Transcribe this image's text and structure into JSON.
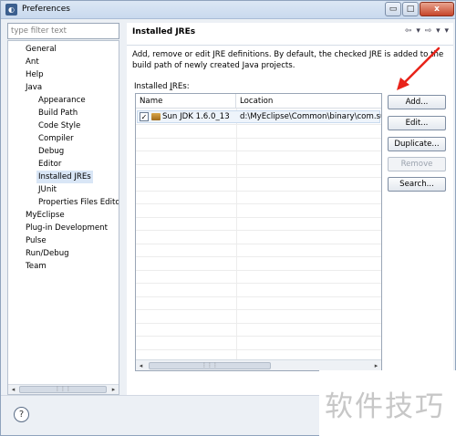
{
  "window": {
    "title": "Preferences",
    "controls": {
      "minimize": "▭",
      "maximize": "□",
      "close": "x"
    }
  },
  "sidebar": {
    "filter_placeholder": "type filter text",
    "tree": [
      {
        "label": "General",
        "level": 0
      },
      {
        "label": "Ant",
        "level": 0
      },
      {
        "label": "Help",
        "level": 0
      },
      {
        "label": "Java",
        "level": 0
      },
      {
        "label": "Appearance",
        "level": 1
      },
      {
        "label": "Build Path",
        "level": 1
      },
      {
        "label": "Code Style",
        "level": 1
      },
      {
        "label": "Compiler",
        "level": 1
      },
      {
        "label": "Debug",
        "level": 1
      },
      {
        "label": "Editor",
        "level": 1
      },
      {
        "label": "Installed JREs",
        "level": 1,
        "selected": true
      },
      {
        "label": "JUnit",
        "level": 1
      },
      {
        "label": "Properties Files Edito",
        "level": 1
      },
      {
        "label": "MyEclipse",
        "level": 0
      },
      {
        "label": "Plug-in Development",
        "level": 0
      },
      {
        "label": "Pulse",
        "level": 0
      },
      {
        "label": "Run/Debug",
        "level": 0
      },
      {
        "label": "Team",
        "level": 0
      }
    ]
  },
  "page": {
    "title": "Installed JREs",
    "nav": "⇦ ▾ ⇨ ▾ ▾",
    "description": "Add, remove or edit JRE definitions. By default, the checked JRE is added to the build path of newly created Java projects.",
    "installed_label_pre": "Installed ",
    "installed_label_mnemonic": "J",
    "installed_label_post": "REs:",
    "table": {
      "columns": [
        "Name",
        "Location"
      ],
      "rows": [
        {
          "checked": true,
          "name": "Sun JDK 1.6.0_13",
          "location": "d:\\MyEclipse\\Common\\binary\\com.su"
        }
      ]
    },
    "buttons": {
      "add": "Add...",
      "edit": "Edit...",
      "duplicate": "Duplicate...",
      "remove": "Remove",
      "search": "Search..."
    }
  },
  "footer": {
    "help": "?"
  },
  "watermark": "软件技巧",
  "colors": {
    "accent": "#d9e6f6",
    "annotation_arrow": "#e8231a"
  }
}
